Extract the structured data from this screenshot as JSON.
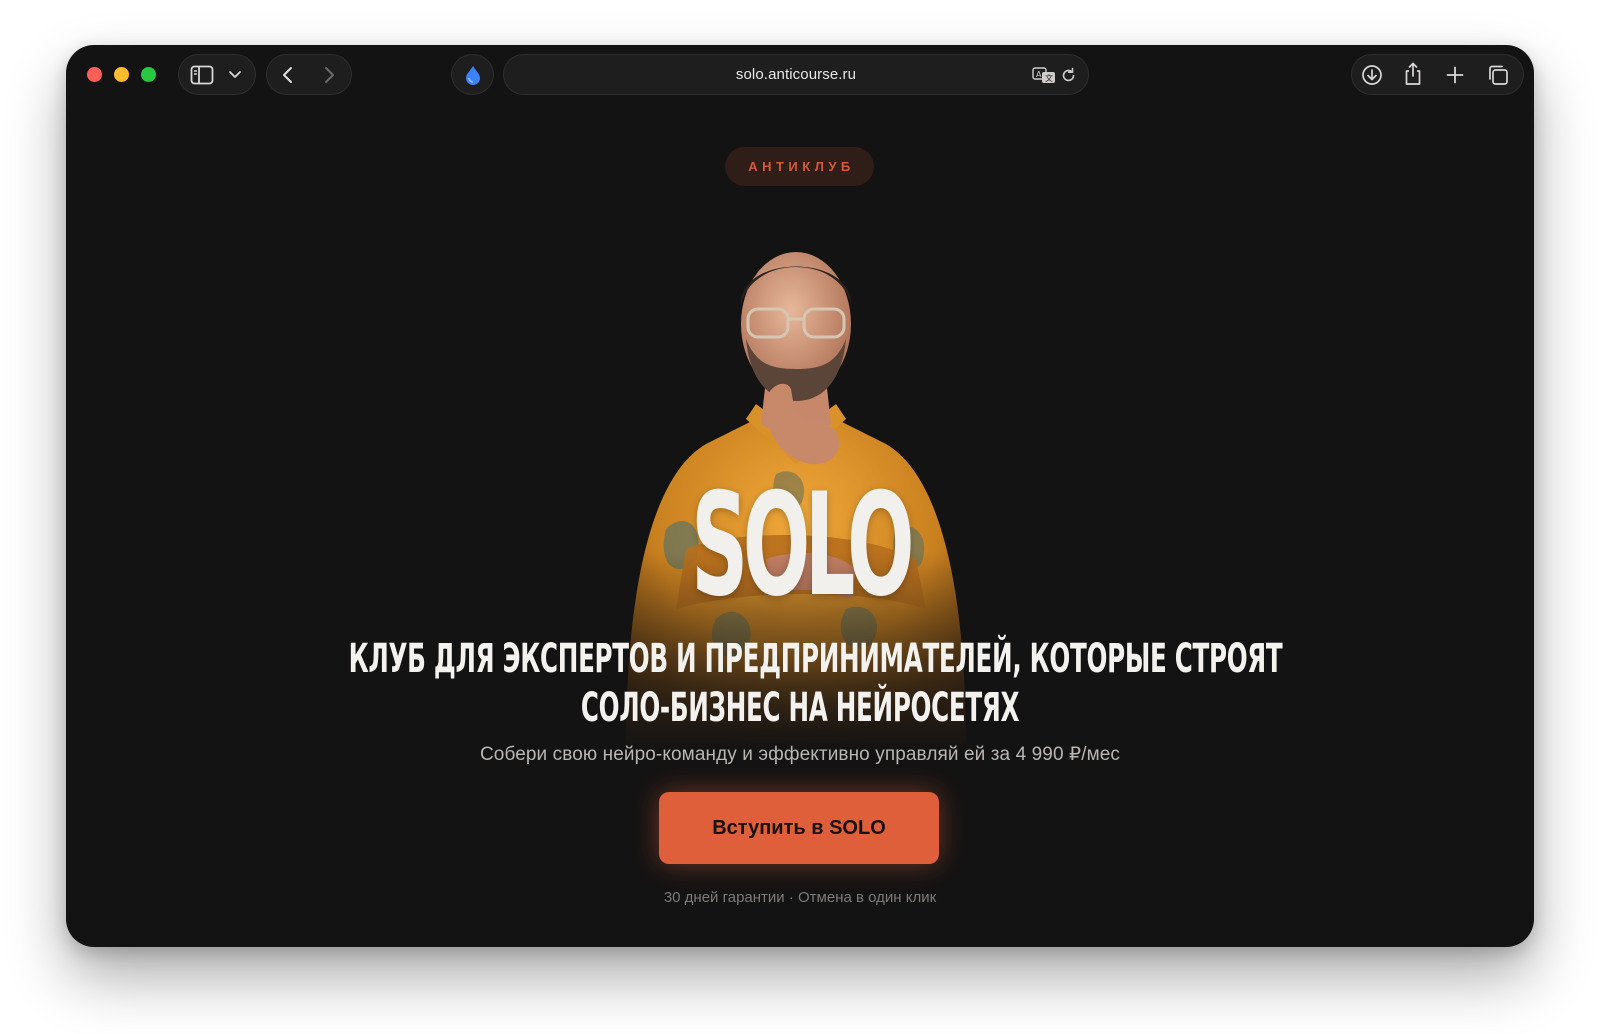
{
  "browser": {
    "url": "solo.anticourse.ru"
  },
  "page": {
    "badge": "АНТИКЛУБ",
    "brand": "SOLO",
    "headline_line1": "КЛУБ ДЛЯ ЭКСПЕРТОВ И ПРЕДПРИНИМАТЕЛЕЙ, КОТОРЫЕ СТРОЯТ",
    "headline_line2": "СОЛО-БИЗНЕС НА НЕЙРОСЕТЯХ",
    "subtitle": "Собери свою нейро-команду и эффективно управляй ей за 4 990 ₽/мес",
    "cta_label": "Вступить в SOLO",
    "guarantee": "30 дней гарантии · Отмена в один клик"
  },
  "colors": {
    "background": "#141313",
    "accent": "#de5f3a",
    "badge_background": "#2f1d17",
    "badge_text": "#d8583a",
    "shirt": "#e8a02c"
  },
  "icons": [
    "sidebar-icon",
    "chevron-down-icon",
    "back-arrow-icon",
    "forward-arrow-icon",
    "extension-drop-icon",
    "translate-icon",
    "reload-icon",
    "download-icon",
    "share-icon",
    "new-tab-plus-icon",
    "tab-overview-icon"
  ]
}
